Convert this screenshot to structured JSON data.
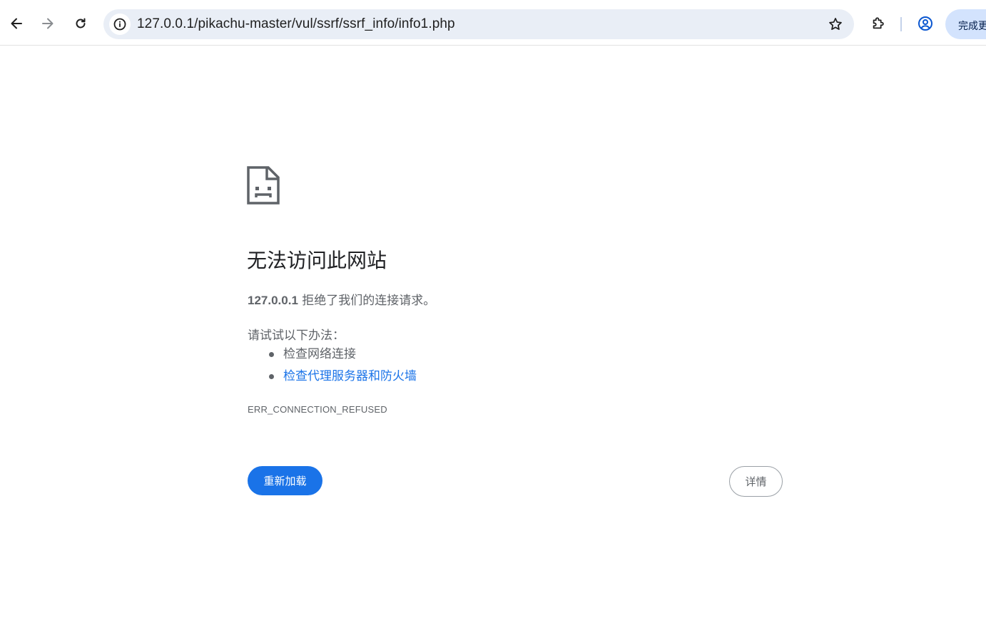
{
  "browser": {
    "url": "127.0.0.1/pikachu-master/vul/ssrf/ssrf_info/info1.php",
    "update_label": "完成更新",
    "icons": {
      "back": "back-arrow-icon",
      "forward": "forward-arrow-icon",
      "reload": "reload-icon",
      "site_info": "info-icon",
      "bookmark": "star-icon",
      "extensions": "puzzle-icon",
      "profile": "account-circle-icon"
    }
  },
  "error_page": {
    "title": "无法访问此网站",
    "host": "127.0.0.1",
    "message": " 拒绝了我们的连接请求。",
    "try_label": "请试试以下办法：",
    "suggestions": [
      {
        "text": "检查网络连接",
        "is_link": false
      },
      {
        "text": "检查代理服务器和防火墙",
        "is_link": true
      }
    ],
    "error_code": "ERR_CONNECTION_REFUSED",
    "reload_label": "重新加载",
    "details_label": "详情",
    "icon": "sad-page-icon"
  },
  "colors": {
    "accent": "#1a73e8",
    "text_secondary": "#5f6368",
    "omnibox_bg": "#e9eef6",
    "update_pill_bg": "#d3e3fd"
  }
}
